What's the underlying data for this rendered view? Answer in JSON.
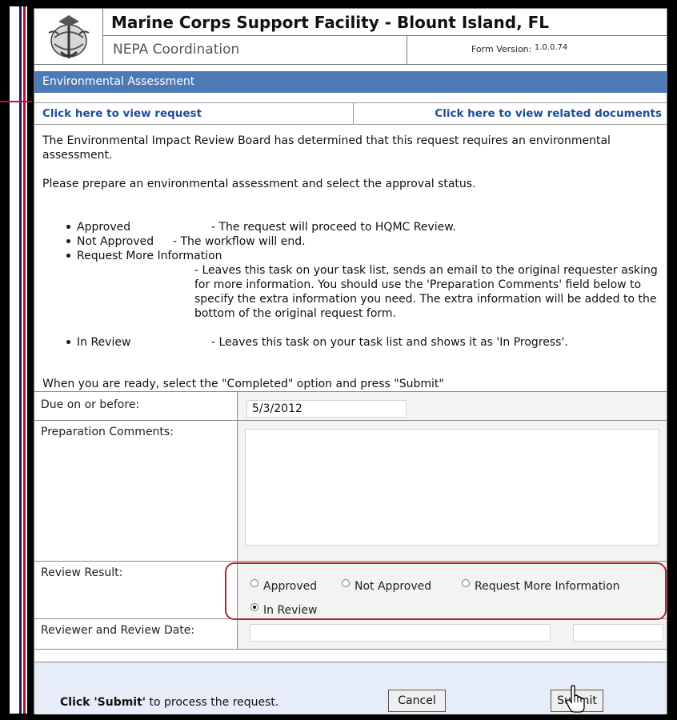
{
  "header": {
    "title": "Marine Corps Support Facility - Blount Island, FL",
    "subtitle": "NEPA Coordination",
    "version_label": "Form Version:",
    "version_value": "1.0.0.74",
    "logo_icon": "marine-corps-emblem-icon"
  },
  "section_title": "Environmental Assessment",
  "links": {
    "view_request": "Click here to view request",
    "view_documents": "Click here to view related documents"
  },
  "intro": {
    "p1": "The Environmental Impact Review Board has determined that this request requires an environmental assessment.",
    "p2": "Please prepare an environmental assessment and select the approval status.",
    "bullets": [
      {
        "term": "Approved",
        "desc": "- The request will proceed to HQMC Review."
      },
      {
        "term": "Not Approved",
        "desc": "- The workflow will end."
      },
      {
        "term": "Request More Information",
        "desc": "- Leaves this task on your task list, sends an email to the original requester asking for more information. You should use the 'Preparation Comments' field below to specify the extra information you need. The extra information will be added to the bottom of the original request form."
      },
      {
        "term": "In Review",
        "desc": "- Leaves this task on your task list and shows it as 'In Progress'."
      }
    ],
    "p3": "When you are ready, select the \"Completed\" option and press \"Submit\""
  },
  "fields": {
    "due_label": "Due on or before:",
    "due_value": "5/3/2012",
    "comments_label": "Preparation Comments:",
    "comments_value": "",
    "review_label": "Review Result:",
    "review_options": [
      "Approved",
      "Not Approved",
      "Request More Information",
      "In Review"
    ],
    "review_selected": "In Review",
    "reviewer_label": "Reviewer and Review Date:",
    "reviewer_value": "",
    "review_date_value": ""
  },
  "footer": {
    "text_bold": "Click 'Submit'",
    "text_rest": " to process the request.",
    "cancel_label": "Cancel",
    "submit_label": "Submit"
  },
  "colors": {
    "section_bar": "#4d79b6",
    "link": "#1f4e9a",
    "highlight_ring": "#b3262c"
  }
}
